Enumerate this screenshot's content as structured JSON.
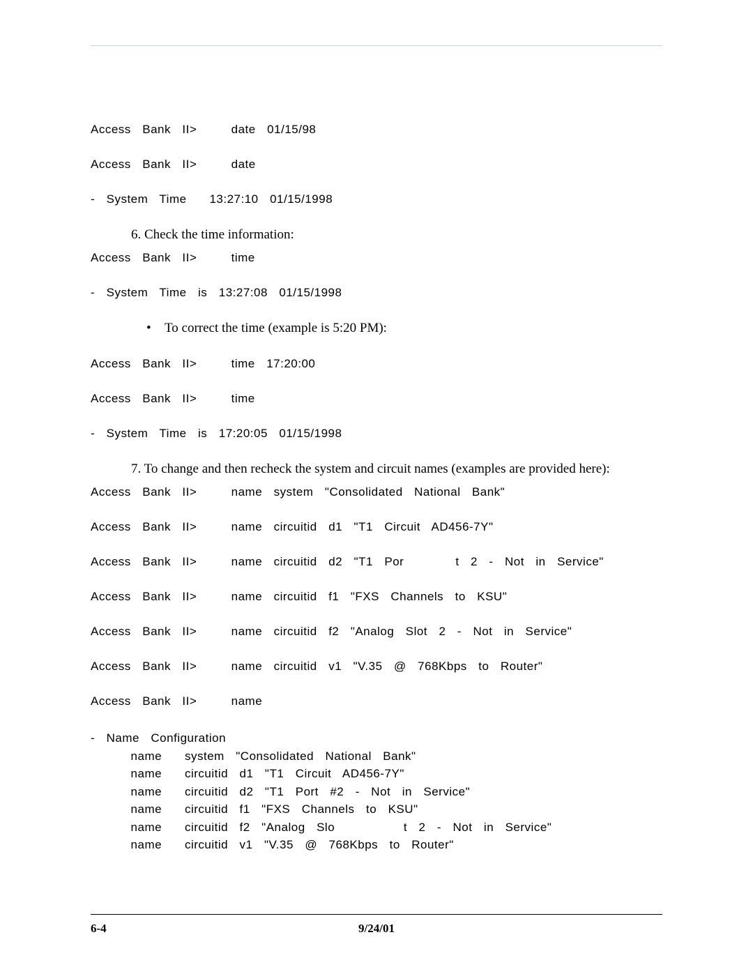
{
  "cli": {
    "line1": "Access  Bank  II>      date  01/15/98",
    "line2": "Access  Bank  II>      date",
    "line3": "-  System  Time    13:27:10  01/15/1998",
    "line4": "Access  Bank  II>      time",
    "line5": "-  System  Time  is  13:27:08  01/15/1998",
    "line6": "Access  Bank  II>      time  17:20:00",
    "line7": "Access  Bank  II>      time",
    "line8": "-  System  Time  is  17:20:05  01/15/1998",
    "line9": "Access  Bank  II>      name  system  \"Consolidated  National  Bank\"",
    "line10": "Access  Bank  II>      name  circuitid  d1  \"T1  Circuit  AD456-7Y\"",
    "line11": "Access  Bank  II>      name  circuitid  d2  \"T1  Por         t  2  -  Not  in  Service\"",
    "line12": "Access  Bank  II>      name  circuitid  f1  \"FXS  Channels  to  KSU\"",
    "line13": "Access  Bank  II>      name  circuitid  f2  \"Analog  Slot  2  -  Not  in  Service\"",
    "line14": "Access  Bank  II>      name  circuitid  v1  \"V.35  @  768Kbps  to  Router\"",
    "line15": "Access  Bank  II>      name"
  },
  "instructions": {
    "step6": "6.    Check the time information:",
    "bullet1": "To correct the time (example is 5:20 PM):",
    "step7": "7.    To change and then recheck the system and circuit names (examples are provided here):"
  },
  "config_block": "-  Name  Configuration\n       name    system  \"Consolidated  National  Bank\"\n       name    circuitid  d1  \"T1  Circuit  AD456-7Y\"\n       name    circuitid  d2  \"T1  Port  #2  -  Not  in  Service\"\n       name    circuitid  f1  \"FXS  Channels  to  KSU\"\n       name    circuitid  f2  \"Analog  Slo            t  2  -  Not  in  Service\"\n       name    circuitid  v1  \"V.35  @  768Kbps  to  Router\"",
  "footer": {
    "page": "6-4",
    "date": "9/24/01"
  }
}
